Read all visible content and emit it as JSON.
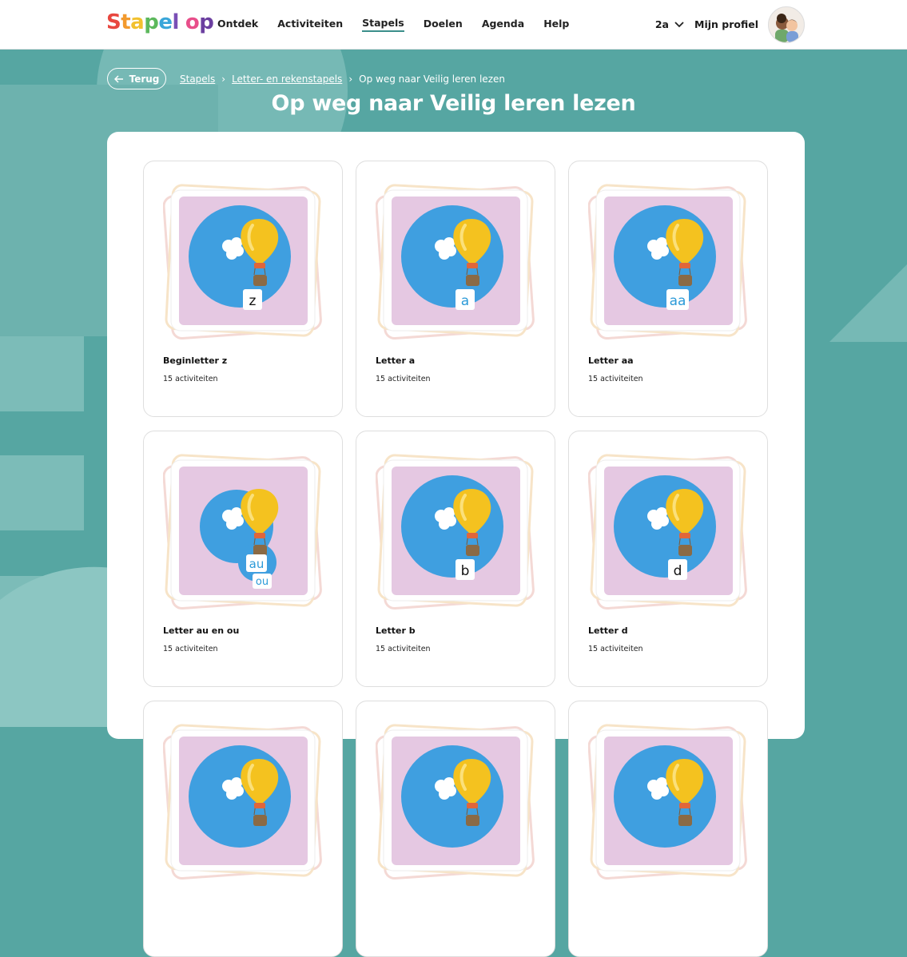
{
  "nav": {
    "logo": [
      {
        "ch": "S",
        "color": "#e8473f"
      },
      {
        "ch": "t",
        "color": "#f29a2e"
      },
      {
        "ch": "a",
        "color": "#f2c12e"
      },
      {
        "ch": "p",
        "color": "#5cb85c"
      },
      {
        "ch": "e",
        "color": "#3aa6d9"
      },
      {
        "ch": "l",
        "color": "#7a4fb5"
      },
      {
        "ch": " ",
        "color": "#ffffff"
      },
      {
        "ch": "o",
        "color": "#e84e8a"
      },
      {
        "ch": "p",
        "color": "#6b3fa0"
      }
    ],
    "items": [
      {
        "label": "Ontdek",
        "active": false
      },
      {
        "label": "Activiteiten",
        "active": false
      },
      {
        "label": "Stapels",
        "active": true
      },
      {
        "label": "Doelen",
        "active": false
      },
      {
        "label": "Agenda",
        "active": false
      },
      {
        "label": "Help",
        "active": false
      }
    ],
    "group": "2a",
    "profile": "Mijn profiel"
  },
  "back_label": "Terug",
  "breadcrumb": {
    "items": [
      "Stapels",
      "Letter- en rekenstapels"
    ],
    "current": "Op weg naar Veilig leren lezen"
  },
  "title": "Op weg naar Veilig leren lezen",
  "cards": [
    {
      "title": "Beginletter z",
      "count": "15 activiteiten",
      "letters": [
        "z"
      ]
    },
    {
      "title": "Letter a",
      "count": "15 activiteiten",
      "letters": [
        "a"
      ]
    },
    {
      "title": "Letter aa",
      "count": "15 activiteiten",
      "letters": [
        "aa"
      ]
    },
    {
      "title": "Letter au en ou",
      "count": "15 activiteiten",
      "letters": [
        "au",
        "ou"
      ]
    },
    {
      "title": "Letter b",
      "count": "15 activiteiten",
      "letters": [
        "b"
      ]
    },
    {
      "title": "Letter d",
      "count": "15 activiteiten",
      "letters": [
        "d"
      ]
    },
    {
      "title": "",
      "count": "",
      "letters": []
    },
    {
      "title": "",
      "count": "",
      "letters": []
    },
    {
      "title": "",
      "count": "",
      "letters": []
    }
  ],
  "colors": {
    "background": "#56a6a2",
    "card_art_bg": "#e5c8e2",
    "circle": "#3f9fe0",
    "balloon": "#f4c21f",
    "letter_blue": "#2b9ad8"
  }
}
